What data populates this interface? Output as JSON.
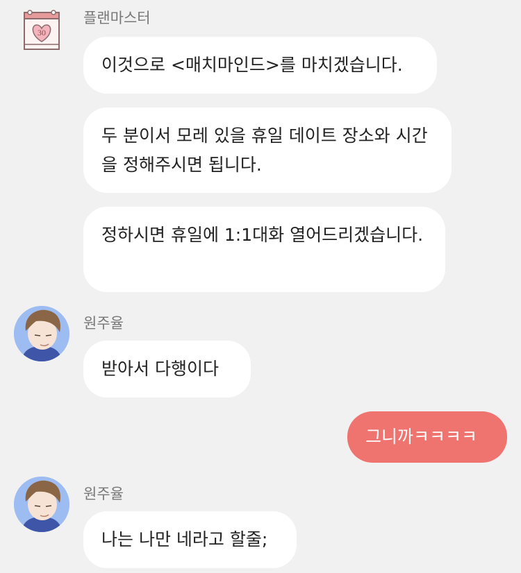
{
  "messages": [
    {
      "sender": "플랜마스터",
      "lines": [
        "이것으로 <매치마인드>를 마치겠습니다.",
        "두 분이서 모레 있을 휴일 데이트 장소와 시간을 정해주시면 됩니다.",
        "정하시면 휴일에 1:1대화 열어드리겠습니다."
      ]
    },
    {
      "sender": "원주율",
      "lines": [
        "받아서 다행이다"
      ]
    },
    {
      "mine": true,
      "lines": [
        "그니까ㅋㅋㅋㅋ"
      ]
    },
    {
      "sender": "원주율",
      "lines": [
        "나는 나만 네라고 할줄;"
      ]
    }
  ],
  "calendar_icon": {
    "day": "30",
    "name": "calendar-heart-icon"
  },
  "colors": {
    "background": "#f1f1f1",
    "bubble": "#ffffff",
    "my_bubble": "#ef7470",
    "sender": "#777777"
  }
}
